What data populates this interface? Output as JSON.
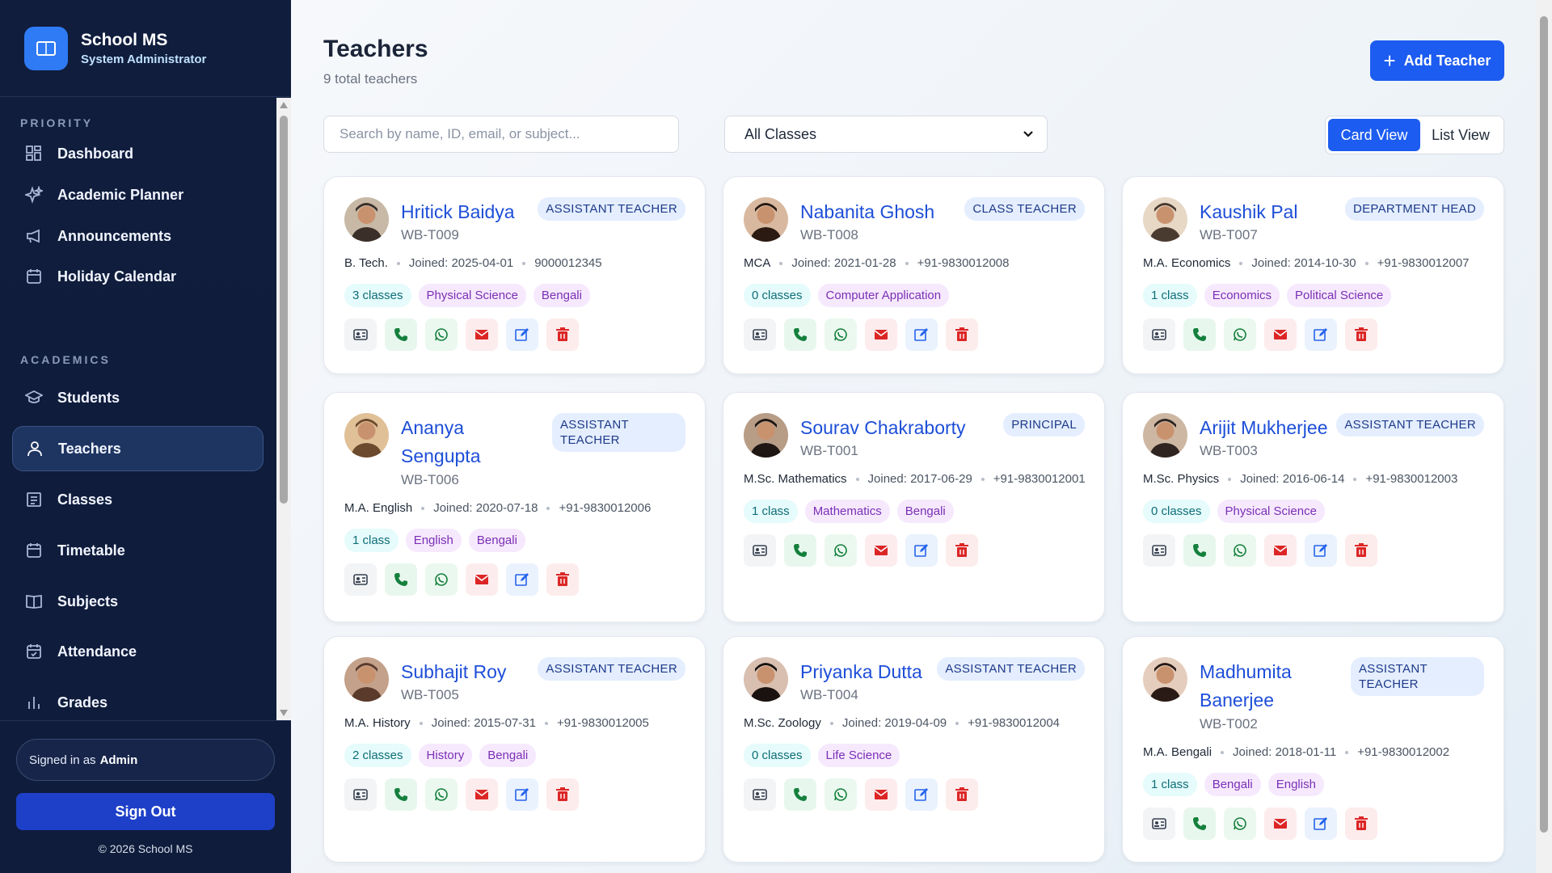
{
  "brand": {
    "title": "School MS",
    "subtitle": "System Administrator"
  },
  "sidebar": {
    "sections": [
      {
        "label": "PRIORITY"
      },
      {
        "label": "ACADEMICS"
      }
    ],
    "items": [
      {
        "label": "Dashboard",
        "icon": "dashboard-icon"
      },
      {
        "label": "Academic Planner",
        "icon": "sparkles-icon"
      },
      {
        "label": "Announcements",
        "icon": "megaphone-icon"
      },
      {
        "label": "Holiday Calendar",
        "icon": "calendar-icon"
      },
      {
        "label": "Students",
        "icon": "graduation-cap-icon"
      },
      {
        "label": "Teachers",
        "icon": "user-icon",
        "active": true
      },
      {
        "label": "Classes",
        "icon": "list-icon"
      },
      {
        "label": "Timetable",
        "icon": "calendar-icon"
      },
      {
        "label": "Subjects",
        "icon": "book-icon"
      },
      {
        "label": "Attendance",
        "icon": "calendar-check-icon"
      },
      {
        "label": "Grades",
        "icon": "bar-chart-icon"
      }
    ],
    "signed_in_prefix": "Signed in as",
    "signed_in_user": "Admin",
    "sign_out": "Sign Out",
    "copyright": "© 2026 School MS"
  },
  "header": {
    "title": "Teachers",
    "subtitle": "9 total teachers",
    "add_button": "Add Teacher"
  },
  "filters": {
    "search_placeholder": "Search by name, ID, email, or subject...",
    "class_select": "All Classes",
    "view_card": "Card View",
    "view_list": "List View"
  },
  "teachers": [
    {
      "name": "Hritick Baidya",
      "id": "WB-T009",
      "role": "ASSISTANT TEACHER",
      "qualification": "B. Tech.",
      "joined": "Joined: 2025-04-01",
      "phone": "9000012345",
      "classes": "3 classes",
      "subjects": [
        "Physical Science",
        "Bengali"
      ]
    },
    {
      "name": "Nabanita Ghosh",
      "id": "WB-T008",
      "role": "CLASS TEACHER",
      "qualification": "MCA",
      "joined": "Joined: 2021-01-28",
      "phone": "+91-9830012008",
      "classes": "0 classes",
      "subjects": [
        "Computer Application"
      ]
    },
    {
      "name": "Kaushik Pal",
      "id": "WB-T007",
      "role": "DEPARTMENT HEAD",
      "qualification": "M.A. Economics",
      "joined": "Joined: 2014-10-30",
      "phone": "+91-9830012007",
      "classes": "1 class",
      "subjects": [
        "Economics",
        "Political Science"
      ]
    },
    {
      "name": "Ananya Sengupta",
      "name_l1": "Ananya",
      "name_l2": "Sengupta",
      "id": "WB-T006",
      "role": "ASSISTANT TEACHER",
      "role_l1": "ASSISTANT",
      "role_l2": "TEACHER",
      "qualification": "M.A. English",
      "joined": "Joined: 2020-07-18",
      "phone": "+91-9830012006",
      "classes": "1 class",
      "subjects": [
        "English",
        "Bengali"
      ]
    },
    {
      "name": "Sourav Chakraborty",
      "id": "WB-T001",
      "role": "PRINCIPAL",
      "qualification": "M.Sc. Mathematics",
      "joined": "Joined: 2017-06-29",
      "phone": "+91-9830012001",
      "classes": "1 class",
      "subjects": [
        "Mathematics",
        "Bengali"
      ]
    },
    {
      "name": "Arijit Mukherjee",
      "id": "WB-T003",
      "role": "ASSISTANT TEACHER",
      "qualification": "M.Sc. Physics",
      "joined": "Joined: 2016-06-14",
      "phone": "+91-9830012003",
      "classes": "0 classes",
      "subjects": [
        "Physical Science"
      ]
    },
    {
      "name": "Subhajit Roy",
      "id": "WB-T005",
      "role": "ASSISTANT TEACHER",
      "qualification": "M.A. History",
      "joined": "Joined: 2015-07-31",
      "phone": "+91-9830012005",
      "classes": "2 classes",
      "subjects": [
        "History",
        "Bengali"
      ]
    },
    {
      "name": "Priyanka Dutta",
      "id": "WB-T004",
      "role": "ASSISTANT TEACHER",
      "qualification": "M.Sc. Zoology",
      "joined": "Joined: 2019-04-09",
      "phone": "+91-9830012004",
      "classes": "0 classes",
      "subjects": [
        "Life Science"
      ]
    },
    {
      "name": "Madhumita Banerjee",
      "name_l1": "Madhumita",
      "name_l2": "Banerjee",
      "id": "WB-T002",
      "role": "ASSISTANT TEACHER",
      "role_l1": "ASSISTANT",
      "role_l2": "TEACHER",
      "qualification": "M.A. Bengali",
      "joined": "Joined: 2018-01-11",
      "phone": "+91-9830012002",
      "classes": "1 class",
      "subjects": [
        "Bengali",
        "English"
      ]
    }
  ],
  "colors": {
    "primary": "#1d5cf0",
    "sidebar_bg": "#101d3d",
    "name_link": "#1d4ed8"
  }
}
